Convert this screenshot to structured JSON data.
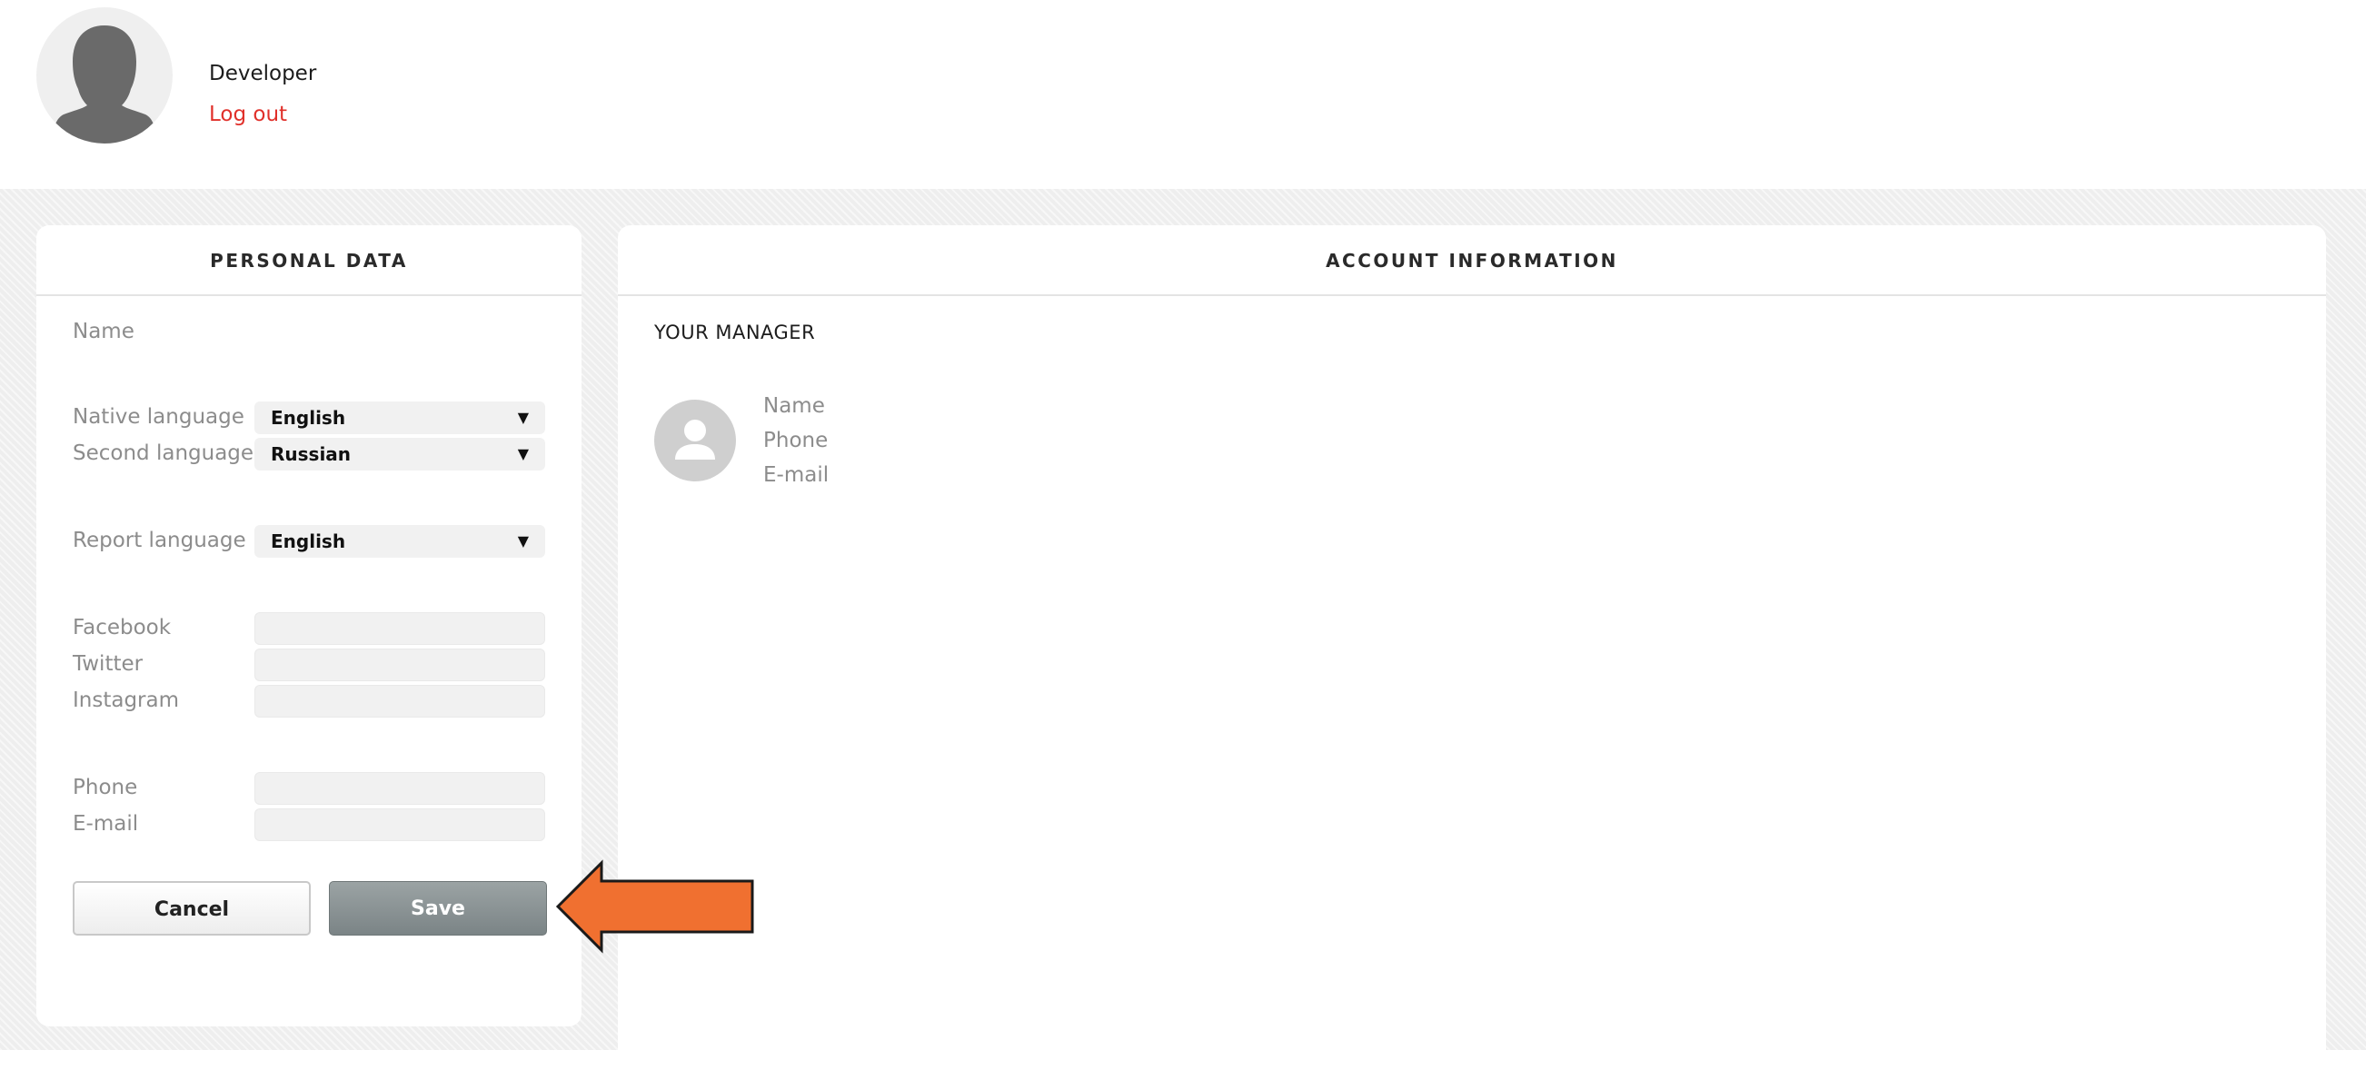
{
  "header": {
    "user_name": "Developer",
    "logout_label": "Log out"
  },
  "personal": {
    "title": "PERSONAL DATA",
    "name_label": "Name",
    "native_language": {
      "label": "Native language",
      "value": "English"
    },
    "second_language": {
      "label": "Second language",
      "value": "Russian"
    },
    "report_language": {
      "label": "Report language",
      "value": "English"
    },
    "facebook_label": "Facebook",
    "twitter_label": "Twitter",
    "instagram_label": "Instagram",
    "phone_label": "Phone",
    "email_label": "E-mail",
    "cancel_label": "Cancel",
    "save_label": "Save"
  },
  "account": {
    "title": "ACCOUNT INFORMATION",
    "manager_heading": "YOUR MANAGER",
    "manager_fields": [
      "Name",
      "Phone",
      "E-mail"
    ]
  },
  "icons": {
    "user_avatar": "person-silhouette-icon",
    "manager_avatar": "person-icon",
    "dropdown": "caret-down-icon",
    "annotation": "arrow-left-icon"
  },
  "colors": {
    "logout": "#e0302a",
    "save_button": "#8a9294",
    "annotation_arrow": "#f07030",
    "content_bg": "#eeeeee"
  }
}
